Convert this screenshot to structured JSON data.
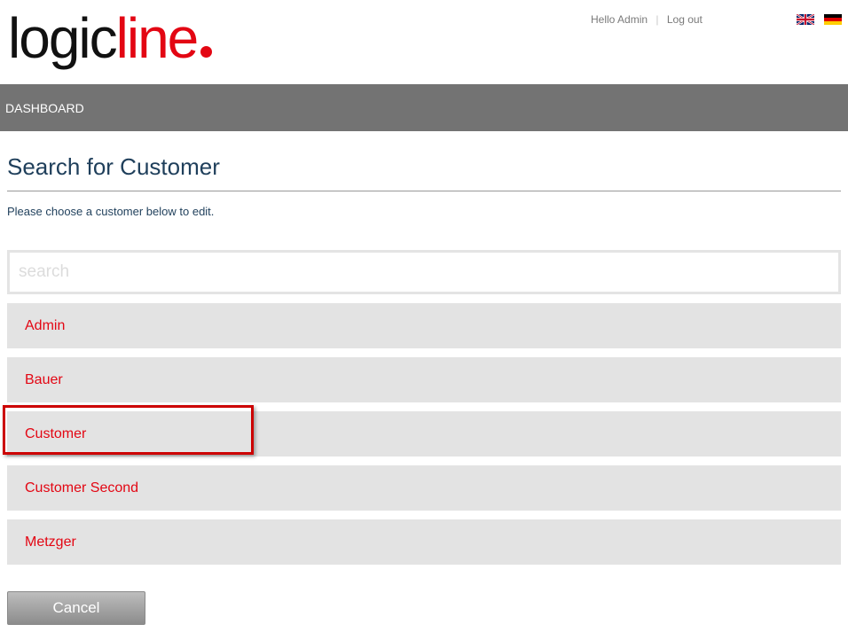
{
  "brand": {
    "logo_part1": "logic",
    "logo_part2": "line",
    "logo_color": "#e30613"
  },
  "user_nav": {
    "greeting": "Hello Admin",
    "separator": "|",
    "logout_label": "Log out"
  },
  "languages": [
    {
      "icon": "uk-flag-icon",
      "lang": "en"
    },
    {
      "icon": "germany-flag-icon",
      "lang": "de"
    }
  ],
  "navbar": {
    "items": [
      {
        "label": "DASHBOARD"
      }
    ],
    "background": "#737373"
  },
  "page": {
    "title": "Search for Customer",
    "intro": "Please choose a customer below to edit.",
    "search_placeholder": "search",
    "search_value": ""
  },
  "customers": [
    {
      "label": "Admin"
    },
    {
      "label": "Bauer"
    },
    {
      "label": "Customer",
      "highlighted": true
    },
    {
      "label": "Customer Second"
    },
    {
      "label": "Metzger"
    }
  ],
  "actions": {
    "cancel_label": "Cancel"
  },
  "colors": {
    "accent_red": "#e30613",
    "title_blue": "#1f3f5b",
    "list_bg": "#e3e3e3",
    "highlight_border": "#cc0000"
  }
}
